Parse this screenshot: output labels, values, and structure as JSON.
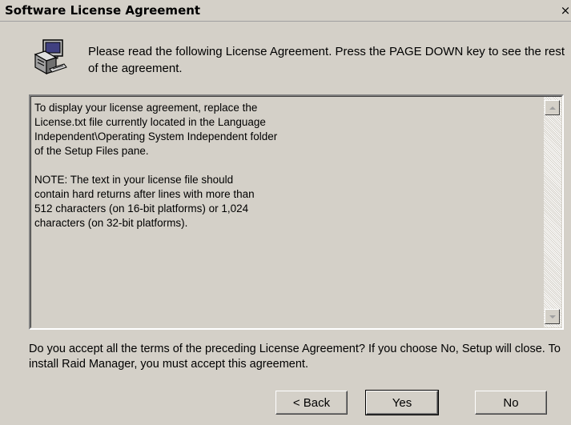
{
  "window": {
    "title": "Software License Agreement",
    "close_symbol": "×"
  },
  "header": {
    "icon": "computer-setup-icon",
    "instruction": "Please read the following License Agreement.  Press the PAGE DOWN key to see the rest of the agreement."
  },
  "license": {
    "lines": [
      "To display your license agreement, replace the",
      "License.txt file currently located in the Language",
      "Independent\\Operating System Independent folder",
      "of the Setup Files pane.",
      "",
      "NOTE: The text in your license file should",
      "contain hard returns after lines with more than",
      "512 characters (on 16-bit platforms) or 1,024",
      "characters (on 32-bit platforms)."
    ],
    "scroll_up_icon": "scroll-up-arrow-icon",
    "scroll_down_icon": "scroll-down-arrow-icon"
  },
  "accept_prompt": "Do you accept all the terms of the preceding License Agreement?  If you choose No,  Setup will close.  To install Raid Manager, you must accept this agreement.",
  "buttons": {
    "back": "< Back",
    "yes": "Yes",
    "no": "No"
  },
  "colors": {
    "dialog_bg": "#d4d0c8",
    "text": "#000000"
  }
}
